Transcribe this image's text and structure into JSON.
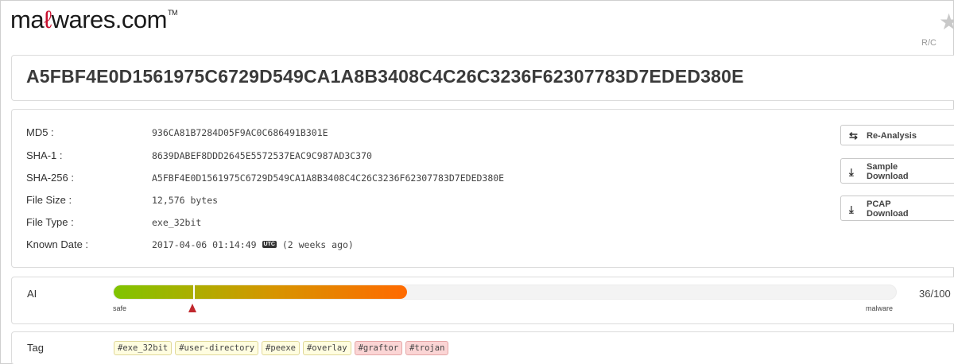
{
  "header": {
    "logo_prefix": "ma",
    "logo_fork": "ℓ",
    "logo_suffix": "wares.com",
    "logo_tm": "TM",
    "star_icon": "star-icon",
    "rc": "R/C"
  },
  "sample": {
    "hash_title": "A5FBF4E0D1561975C6729D549CA1A8B3408C4C26C3236F62307783D7EDED380E"
  },
  "info": {
    "rows": [
      {
        "label": "MD5 :",
        "value": "936CA81B7284D05F9AC0C686491B301E"
      },
      {
        "label": "SHA-1 :",
        "value": "8639DABEF8DDD2645E5572537EAC9C987AD3C370"
      },
      {
        "label": "SHA-256 :",
        "value": "A5FBF4E0D1561975C6729D549CA1A8B3408C4C26C3236F62307783D7EDED380E"
      },
      {
        "label": "File Size :",
        "value": "12,576 bytes"
      },
      {
        "label": "File Type :",
        "value": "exe_32bit"
      },
      {
        "label": "Known Date :",
        "value_date": "2017-04-06 01:14:49",
        "utc_badge": "UTC",
        "value_rel": "(2 weeks ago)"
      }
    ]
  },
  "actions": {
    "reanalysis": "Re-Analysis",
    "sample_line1": "Sample",
    "sample_line2": "Download",
    "pcap_line1": "PCAP",
    "pcap_line2": "Download"
  },
  "ai": {
    "label": "AI",
    "score_text": "36/100",
    "score_fraction": 0.375,
    "safe_label": "safe",
    "malware_label": "malware",
    "gradient_start": "#7fc400",
    "gradient_end": "#ff6a00",
    "marker_color": "#c0282d"
  },
  "tags": {
    "label": "Tag",
    "items": [
      {
        "text": "#exe_32bit",
        "style": "yellow"
      },
      {
        "text": "#user-directory",
        "style": "yellow"
      },
      {
        "text": "#peexe",
        "style": "yellow"
      },
      {
        "text": "#overlay",
        "style": "yellow"
      },
      {
        "text": "#graftor",
        "style": "red"
      },
      {
        "text": "#trojan",
        "style": "red"
      }
    ]
  }
}
